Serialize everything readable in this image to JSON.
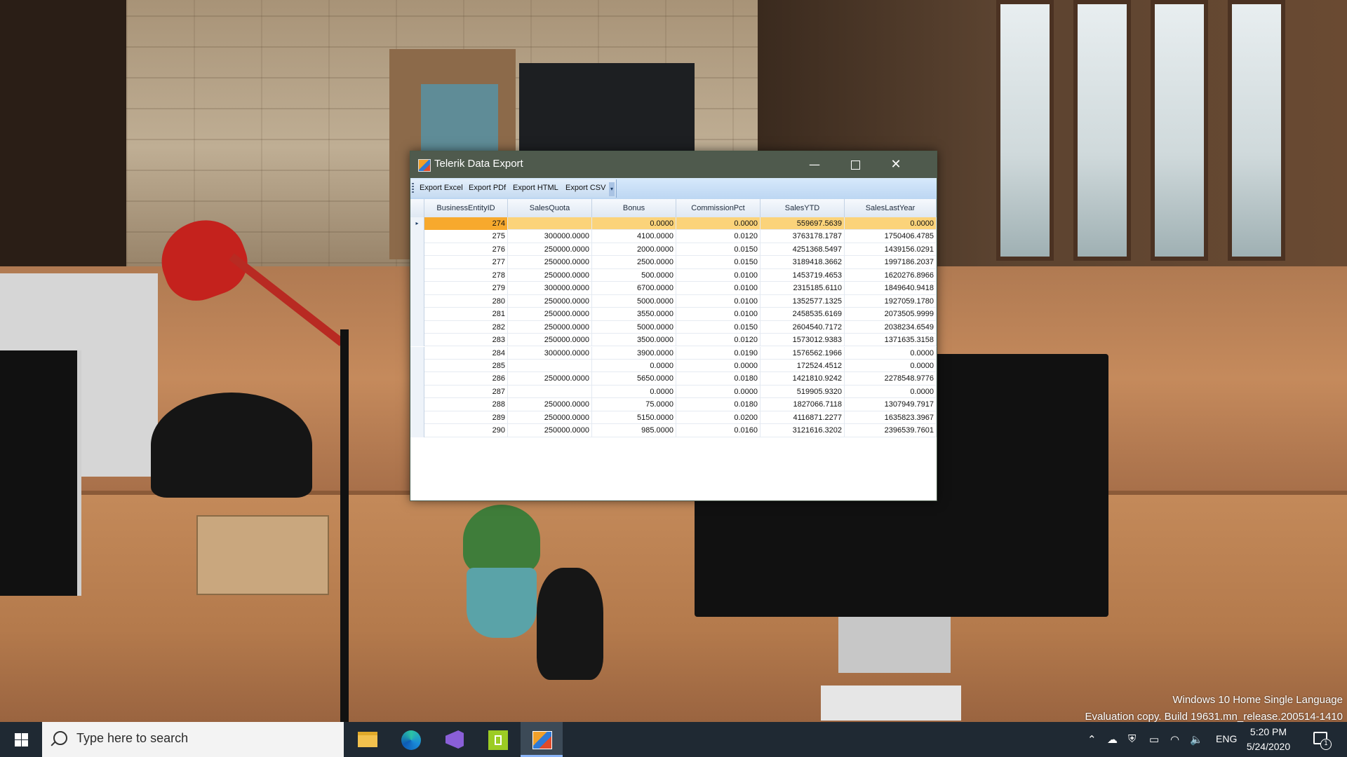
{
  "window": {
    "title": "Telerik Data Export",
    "minimize_glyph": "—",
    "close_glyph": "✕"
  },
  "menu": {
    "items": [
      "Export Excel",
      "Export PDf",
      "Export HTML",
      "Export CSV"
    ],
    "overflow_glyph": "▾"
  },
  "grid": {
    "columns": [
      "BusinessEntityID",
      "SalesQuota",
      "Bonus",
      "CommissionPct",
      "SalesYTD",
      "SalesLastYear"
    ],
    "current_row_glyph": "▸",
    "selected_row_index": 0,
    "rows": [
      [
        "274",
        "",
        "0.0000",
        "0.0000",
        "559697.5639",
        "0.0000"
      ],
      [
        "275",
        "300000.0000",
        "4100.0000",
        "0.0120",
        "3763178.1787",
        "1750406.4785"
      ],
      [
        "276",
        "250000.0000",
        "2000.0000",
        "0.0150",
        "4251368.5497",
        "1439156.0291"
      ],
      [
        "277",
        "250000.0000",
        "2500.0000",
        "0.0150",
        "3189418.3662",
        "1997186.2037"
      ],
      [
        "278",
        "250000.0000",
        "500.0000",
        "0.0100",
        "1453719.4653",
        "1620276.8966"
      ],
      [
        "279",
        "300000.0000",
        "6700.0000",
        "0.0100",
        "2315185.6110",
        "1849640.9418"
      ],
      [
        "280",
        "250000.0000",
        "5000.0000",
        "0.0100",
        "1352577.1325",
        "1927059.1780"
      ],
      [
        "281",
        "250000.0000",
        "3550.0000",
        "0.0100",
        "2458535.6169",
        "2073505.9999"
      ],
      [
        "282",
        "250000.0000",
        "5000.0000",
        "0.0150",
        "2604540.7172",
        "2038234.6549"
      ],
      [
        "283",
        "250000.0000",
        "3500.0000",
        "0.0120",
        "1573012.9383",
        "1371635.3158"
      ],
      [
        "284",
        "300000.0000",
        "3900.0000",
        "0.0190",
        "1576562.1966",
        "0.0000"
      ],
      [
        "285",
        "",
        "0.0000",
        "0.0000",
        "172524.4512",
        "0.0000"
      ],
      [
        "286",
        "250000.0000",
        "5650.0000",
        "0.0180",
        "1421810.9242",
        "2278548.9776"
      ],
      [
        "287",
        "",
        "0.0000",
        "0.0000",
        "519905.9320",
        "0.0000"
      ],
      [
        "288",
        "250000.0000",
        "75.0000",
        "0.0180",
        "1827066.7118",
        "1307949.7917"
      ],
      [
        "289",
        "250000.0000",
        "5150.0000",
        "0.0200",
        "4116871.2277",
        "1635823.3967"
      ],
      [
        "290",
        "250000.0000",
        "985.0000",
        "0.0160",
        "3121616.3202",
        "2396539.7601"
      ]
    ]
  },
  "desktop": {
    "watermark_line1": "Windows 10 Home Single Language",
    "watermark_line2": "Evaluation copy. Build 19631.mn_release.200514-1410"
  },
  "taskbar": {
    "search_placeholder": "Type here to search",
    "apps": [
      "file-explorer",
      "edge",
      "visual-studio",
      "android-app",
      "telerik-data-export"
    ],
    "language": "ENG",
    "time": "5:20 PM",
    "date": "5/24/2020",
    "notification_count": "1",
    "tray_glyphs": {
      "chevron": "⌃",
      "onedrive": "☁",
      "security": "⛨",
      "battery": "▭",
      "wifi": "◠",
      "volume": "🔈"
    }
  },
  "colors": {
    "titlebar": "#4f5a4d",
    "selected_row": "#fbd37a",
    "selected_cell": "#f7a92d",
    "taskbar": "#1f2933"
  }
}
